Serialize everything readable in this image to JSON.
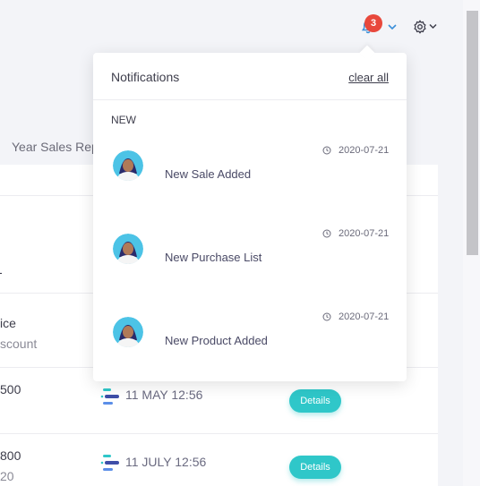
{
  "topbar": {
    "notification_count": "3",
    "bell_icon": "bell-icon",
    "gear_icon": "gear-icon",
    "accent": "#3b8fd9",
    "badge_color": "#e8483c"
  },
  "background": {
    "tab_label": "Year Sales Rep",
    "rows": [
      {
        "label_a": "ice",
        "label_b": "scount"
      },
      {
        "label_a": "500",
        "date": "11 MAY 12:56",
        "action": "Details"
      },
      {
        "label_a": "800",
        "label_b": "20",
        "date": "11 JULY 12:56",
        "action": "Details"
      }
    ]
  },
  "notifications": {
    "title": "Notifications",
    "clear_label": "clear all",
    "section_label": "NEW",
    "items": [
      {
        "text": "New Sale Added",
        "date": "2020-07-21"
      },
      {
        "text": "New Purchase List",
        "date": "2020-07-21"
      },
      {
        "text": "New Product Added",
        "date": "2020-07-21"
      }
    ]
  },
  "colors": {
    "button": "#2fc7c9"
  }
}
